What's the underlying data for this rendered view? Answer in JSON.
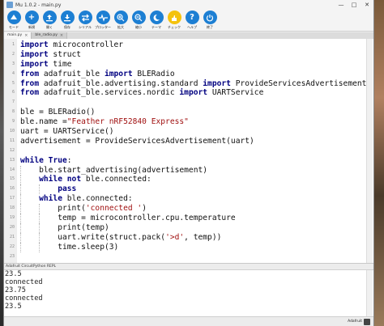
{
  "window": {
    "title": "Mu 1.0.2 - main.py"
  },
  "toolbar": [
    {
      "label": "モード",
      "icon": "mode-icon"
    },
    {
      "label": "新規",
      "icon": "new-icon"
    },
    {
      "label": "開く",
      "icon": "load-icon"
    },
    {
      "label": "保存",
      "icon": "save-icon"
    },
    {
      "label": "シリアル",
      "icon": "serial-icon"
    },
    {
      "label": "プロッター",
      "icon": "plotter-icon"
    },
    {
      "label": "拡大",
      "icon": "zoom-in-icon"
    },
    {
      "label": "縮小",
      "icon": "zoom-out-icon"
    },
    {
      "label": "テーマ",
      "icon": "theme-icon"
    },
    {
      "label": "チェック",
      "icon": "check-icon"
    },
    {
      "label": "ヘルプ",
      "icon": "help-icon"
    },
    {
      "label": "終了",
      "icon": "quit-icon"
    }
  ],
  "tabs": [
    {
      "label": "main.py",
      "active": true
    },
    {
      "label": "ble_radio.py",
      "active": false
    }
  ],
  "editor": {
    "lines": [
      {
        "n": "1",
        "text": "import microcontroller"
      },
      {
        "n": "2",
        "text": "import struct"
      },
      {
        "n": "3",
        "text": "import time"
      },
      {
        "n": "4",
        "text": "from adafruit_ble import BLERadio"
      },
      {
        "n": "5",
        "text": "from adafruit_ble.advertising.standard import ProvideServicesAdvertisement"
      },
      {
        "n": "6",
        "text": "from adafruit_ble.services.nordic import UARTService"
      },
      {
        "n": "7",
        "text": ""
      },
      {
        "n": "8",
        "text": "ble = BLERadio()"
      },
      {
        "n": "9",
        "text": "ble.name =\"Feather nRF52840 Express\""
      },
      {
        "n": "10",
        "text": "uart = UARTService()"
      },
      {
        "n": "11",
        "text": "advertisement = ProvideServicesAdvertisement(uart)"
      },
      {
        "n": "12",
        "text": ""
      },
      {
        "n": "13",
        "text": "while True:"
      },
      {
        "n": "14",
        "text": "    ble.start_advertising(advertisement)"
      },
      {
        "n": "15",
        "text": "    while not ble.connected:"
      },
      {
        "n": "16",
        "text": "        pass"
      },
      {
        "n": "17",
        "text": "    while ble.connected:"
      },
      {
        "n": "18",
        "text": "        print('connected ')"
      },
      {
        "n": "19",
        "text": "        temp = microcontroller.cpu.temperature"
      },
      {
        "n": "20",
        "text": "        print(temp)"
      },
      {
        "n": "21",
        "text": "        uart.write(struct.pack('>d', temp))"
      },
      {
        "n": "22",
        "text": "        time.sleep(3)"
      },
      {
        "n": "23",
        "text": ""
      }
    ]
  },
  "repl": {
    "title": "Adafruit CircuitPython REPL",
    "lines": [
      "23.5",
      "connected",
      "23.75",
      "connected",
      "23.5"
    ]
  },
  "status": {
    "mode": "Adafruit"
  }
}
